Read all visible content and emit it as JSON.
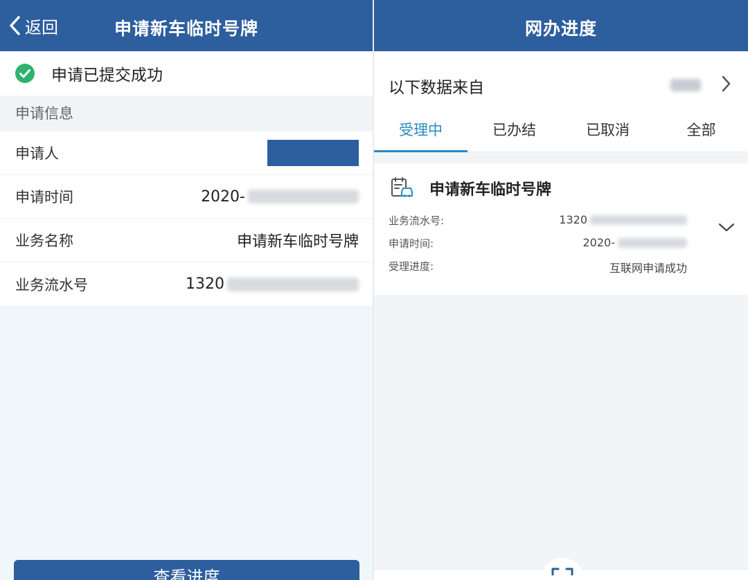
{
  "left": {
    "back_label": "返回",
    "title": "申请新车临时号牌",
    "success_text": "申请已提交成功",
    "section_header": "申请信息",
    "rows": [
      {
        "label": "申请人",
        "value": ""
      },
      {
        "label": "申请时间",
        "value": "2020-"
      },
      {
        "label": "业务名称",
        "value": "申请新车临时号牌"
      },
      {
        "label": "业务流水号",
        "value": "1320"
      }
    ],
    "button_label": "查看进度",
    "accent_color": "#2d5e9e",
    "success_color": "#2db36e"
  },
  "right": {
    "title": "网办进度",
    "source_label": "以下数据来自",
    "tabs": [
      {
        "label": "受理中",
        "active": true
      },
      {
        "label": "已办结",
        "active": false
      },
      {
        "label": "已取消",
        "active": false
      },
      {
        "label": "全部",
        "active": false
      }
    ],
    "card": {
      "icon": "car-document-icon",
      "title": "申请新车临时号牌",
      "fields": [
        {
          "label": "业务流水号:",
          "value": "1320"
        },
        {
          "label": "申请时间:",
          "value": "2020-"
        },
        {
          "label": "受理进度:",
          "value": "互联网申请成功"
        }
      ]
    },
    "tab_active_color": "#2a8bc0"
  }
}
